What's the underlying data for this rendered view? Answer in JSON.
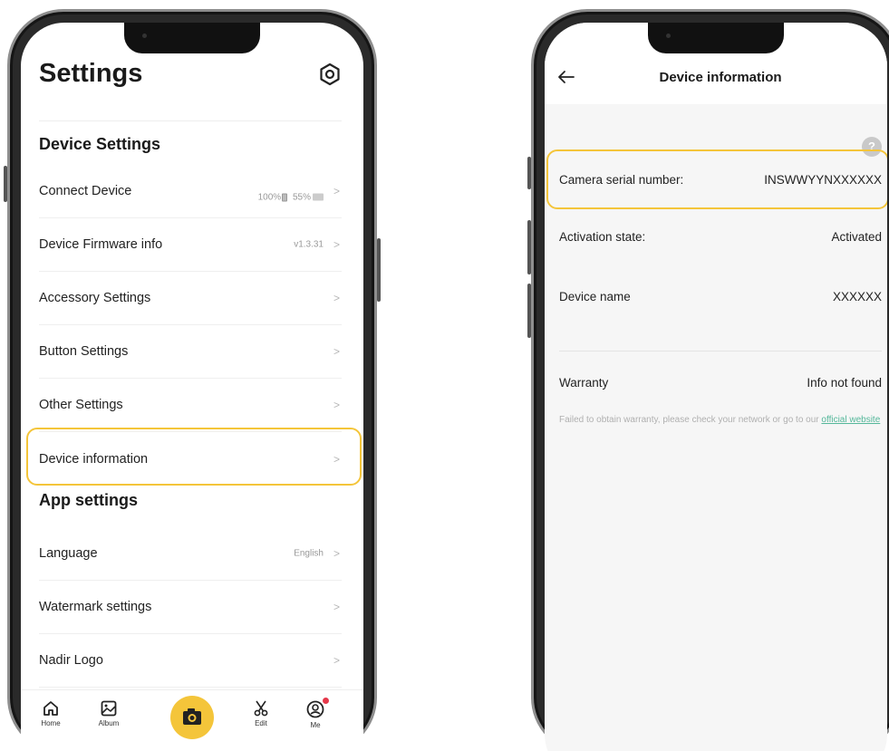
{
  "left_screen": {
    "title": "Settings",
    "device_settings_heading": "Device Settings",
    "rows": [
      {
        "label": "Connect Device",
        "value_battery": "100%",
        "value_storage": "55%"
      },
      {
        "label": "Device Firmware info",
        "value": "v1.3.31"
      },
      {
        "label": "Accessory Settings",
        "value": ""
      },
      {
        "label": "Button Settings",
        "value": ""
      },
      {
        "label": "Other Settings",
        "value": ""
      },
      {
        "label": "Device information",
        "value": ""
      }
    ],
    "app_settings_heading": "App settings",
    "app_rows": [
      {
        "label": "Language",
        "value": "English"
      },
      {
        "label": "Watermark settings",
        "value": ""
      },
      {
        "label": "Nadir Logo",
        "value": ""
      }
    ],
    "chevron": ">",
    "tabs": [
      {
        "label": "Home",
        "icon": "home-icon"
      },
      {
        "label": "Album",
        "icon": "album-icon"
      },
      {
        "label": "",
        "icon": "camera-icon"
      },
      {
        "label": "Edit",
        "icon": "scissors-icon"
      },
      {
        "label": "Me",
        "icon": "profile-icon"
      }
    ],
    "accent_color": "#f4c53a",
    "notification_color": "#e5384a"
  },
  "right_screen": {
    "title": "Device information",
    "help": "?",
    "rows": [
      {
        "key": "Camera serial number:",
        "value": "INSWWYYNXXXXXX"
      },
      {
        "key": "Activation state:",
        "value": "Activated"
      },
      {
        "key": "Device name",
        "value": "XXXXXX"
      },
      {
        "key": "Warranty",
        "value": "Info not found"
      }
    ],
    "warranty_note": "Failed to obtain warranty, please check your network or go to our",
    "warranty_link": "official website",
    "link_color": "#54b79a"
  }
}
